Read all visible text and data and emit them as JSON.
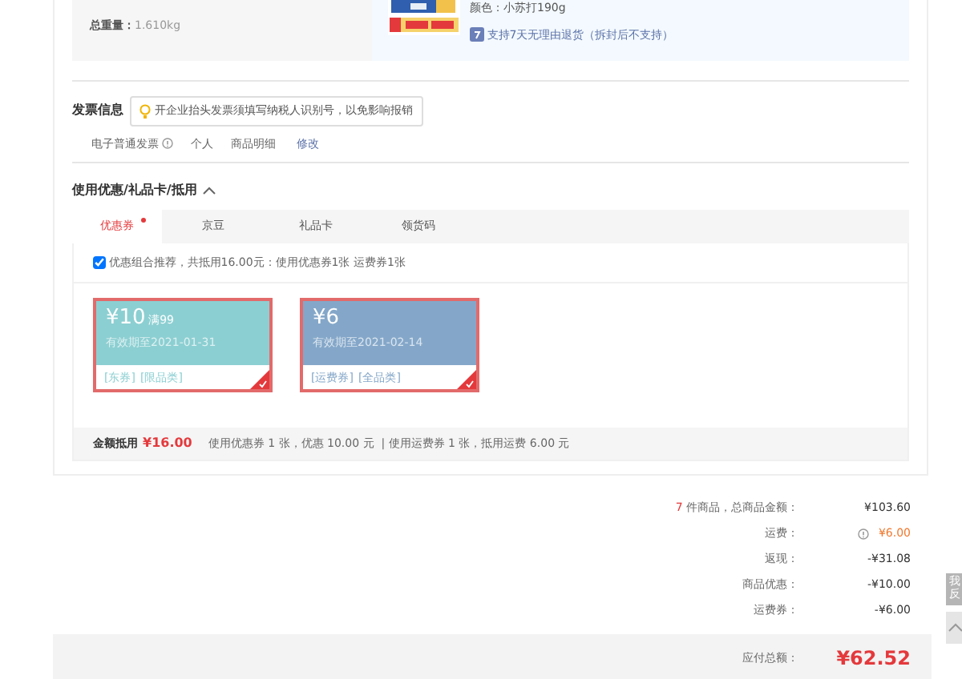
{
  "order_top": {
    "total_weight_label": "总重量：",
    "total_weight": "1.610kg",
    "product": {
      "kind": "picture",
      "spec": "颜色：小苏打190g",
      "return_policy": "支持7天无理由退货（拆封后不支持）"
    }
  },
  "invoice": {
    "title": "发票信息",
    "tip": "开企业抬头发票须填写纳税人识别号，以免影响报销",
    "type": "电子普通发票",
    "holder": "个人",
    "content": "商品明细",
    "edit_link": "修改"
  },
  "discounts": {
    "title": "使用优惠/礼品卡/抵用",
    "expanded": true,
    "tabs": [
      {
        "label": "优惠券",
        "selected": true,
        "dot": true
      },
      {
        "label": "京豆",
        "selected": false,
        "dot": false
      },
      {
        "label": "礼品卡",
        "selected": false,
        "dot": false
      },
      {
        "label": "领货码",
        "selected": false,
        "dot": false
      }
    ],
    "recommend": {
      "checked": true,
      "text": "优惠组合推荐，共抵用16.00元：使用优惠券1张 运费券1张"
    },
    "coupons": [
      {
        "amount": "¥10",
        "condition": "满99",
        "expiry": "有效期至2021-01-31",
        "tags": [
          "[东券]",
          "[限品类]"
        ],
        "color": "#8ccfd2",
        "selected": true
      },
      {
        "amount": "¥6",
        "expiry": "有效期至2021-02-14",
        "tags": [
          "[运费券]",
          "[全品类]"
        ],
        "color": "#84a7c9",
        "selected": true
      }
    ],
    "summary_label": "金额抵用",
    "summary_amount": "¥16.00",
    "summary_detail": "使用优惠券 1 张，优惠 10.00 元  | 使用运费券 1 张，抵用运费 6.00 元"
  },
  "totals": {
    "count": "7",
    "count_label": "件商品，总商品金额：",
    "rows_first_value": "¥103.60",
    "rows": [
      {
        "label": "运费：",
        "value": "¥6.00",
        "kind": "info"
      },
      {
        "label": "返现：",
        "value": "-¥31.08",
        "kind": "plain"
      },
      {
        "label": "商品优惠：",
        "value": "-¥10.00",
        "kind": "plain"
      },
      {
        "label": "运费券：",
        "value": "-¥6.00",
        "kind": "plain"
      }
    ],
    "payable_label": "应付总额：",
    "payable": "¥62.52"
  },
  "side_tab": "我反"
}
